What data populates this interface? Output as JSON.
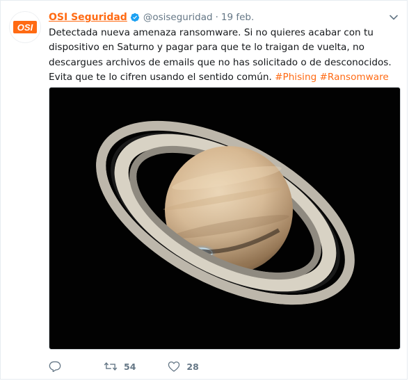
{
  "tweet": {
    "author_name": "OSI Seguridad",
    "handle": "@osiseguridad",
    "separator": "·",
    "date": "19 feb.",
    "avatar_text": "OSI",
    "text": "Detectada nueva amenaza ransomware. Si no quieres acabar con tu dispositivo en Saturno y pagar para que te lo traigan de vuelta, no descargues archivos de emails que no has solicitado o de desconocidos. Evita que te lo cifren usando el sentido común.",
    "hashtags": [
      "#Phising",
      "#Ransomware"
    ],
    "media_icon": "saturn-image",
    "retweets": "54",
    "likes": "28"
  },
  "icons": {
    "verified": "verified-icon",
    "caret": "chevron-down-icon",
    "reply": "reply-icon",
    "retweet": "retweet-icon",
    "like": "heart-icon"
  },
  "colors": {
    "brand": "#ff6a13",
    "verified": "#1da1f2",
    "muted": "#657786"
  }
}
